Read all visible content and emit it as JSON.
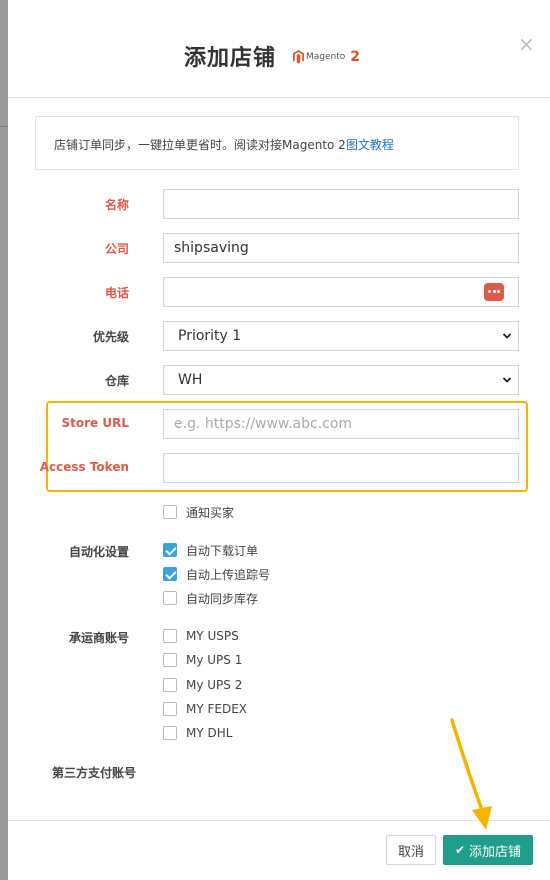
{
  "modal": {
    "title": "添加店铺",
    "brand_name": "Magento",
    "brand_version": "2",
    "close": "×"
  },
  "info": {
    "text": "店铺订单同步，一键拉单更省时。阅读对接Magento 2",
    "link": "图文教程"
  },
  "form": {
    "name_label": "名称",
    "name_value": "",
    "company_label": "公司",
    "company_value": "shipsaving",
    "phone_label": "电话",
    "phone_value": "",
    "priority_label": "优先级",
    "priority_value": "Priority 1",
    "warehouse_label": "仓库",
    "warehouse_value": "WH",
    "store_url_label": "Store URL",
    "store_url_placeholder": "e.g. https://www.abc.com",
    "access_token_label": "Access Token",
    "access_token_value": "",
    "notify_label": "通知买家",
    "automation_label": "自动化设置",
    "auto_download_label": "自动下载订单",
    "auto_upload_label": "自动上传追踪号",
    "auto_sync_label": "自动同步库存",
    "carrier_label": "承运商账号",
    "carriers": [
      "MY USPS",
      "My UPS 1",
      "My UPS 2",
      "MY FEDEX",
      "MY DHL"
    ],
    "third_party_label": "第三方支付账号"
  },
  "footer": {
    "cancel": "取消",
    "submit": "添加店铺",
    "submit_icon": "check-icon"
  },
  "colors": {
    "required_label": "#e05a4a",
    "highlight": "#f6b400",
    "primary": "#1f9e8b",
    "checkbox_on": "#3aa3d8",
    "link": "#1a73c6"
  }
}
